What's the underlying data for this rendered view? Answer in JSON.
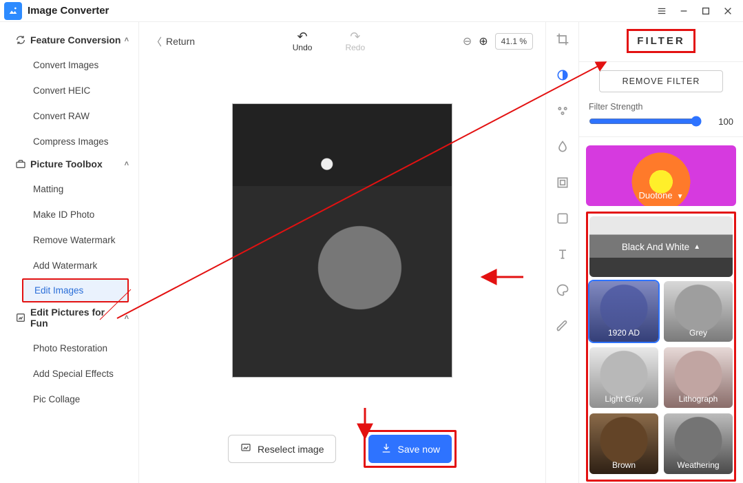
{
  "app": {
    "title": "Image Converter"
  },
  "titlebar": {
    "menu_icon": "menu-icon",
    "min_icon": "minimize-icon",
    "max_icon": "maximize-icon",
    "close_icon": "close-icon"
  },
  "sidebar": {
    "sections": [
      {
        "title": "Feature Conversion",
        "items": [
          {
            "label": "Convert Images"
          },
          {
            "label": "Convert HEIC"
          },
          {
            "label": "Convert RAW"
          },
          {
            "label": "Compress Images"
          }
        ]
      },
      {
        "title": "Picture Toolbox",
        "items": [
          {
            "label": "Matting"
          },
          {
            "label": "Make ID Photo"
          },
          {
            "label": "Remove Watermark"
          },
          {
            "label": "Add Watermark"
          },
          {
            "label": "Edit Images",
            "active": true
          }
        ]
      },
      {
        "title": "Edit Pictures for Fun",
        "items": [
          {
            "label": "Photo Restoration"
          },
          {
            "label": "Add Special Effects"
          },
          {
            "label": "Pic Collage"
          }
        ]
      }
    ]
  },
  "workspace": {
    "return_label": "Return",
    "undo_label": "Undo",
    "redo_label": "Redo",
    "zoom_value": "41.1 %",
    "reselect_label": "Reselect image",
    "save_label": "Save now"
  },
  "toolstrip": {
    "items": [
      {
        "name": "crop-icon"
      },
      {
        "name": "color-icon"
      },
      {
        "name": "adjust-icon"
      },
      {
        "name": "blur-icon"
      },
      {
        "name": "frame-square-icon"
      },
      {
        "name": "frame-outline-icon"
      },
      {
        "name": "text-icon"
      },
      {
        "name": "palette-icon"
      },
      {
        "name": "brush-icon"
      }
    ]
  },
  "filter_panel": {
    "title": "FILTER",
    "remove_label": "REMOVE FILTER",
    "strength_label": "Filter Strength",
    "strength_value": "100",
    "categories": [
      {
        "name": "Duotone",
        "expanded": false
      },
      {
        "name": "Black And White",
        "expanded": true
      }
    ],
    "presets": [
      {
        "name": "1920 AD",
        "selected": true
      },
      {
        "name": "Grey"
      },
      {
        "name": "Light Gray"
      },
      {
        "name": "Lithograph"
      },
      {
        "name": "Brown"
      },
      {
        "name": "Weathering"
      }
    ]
  }
}
